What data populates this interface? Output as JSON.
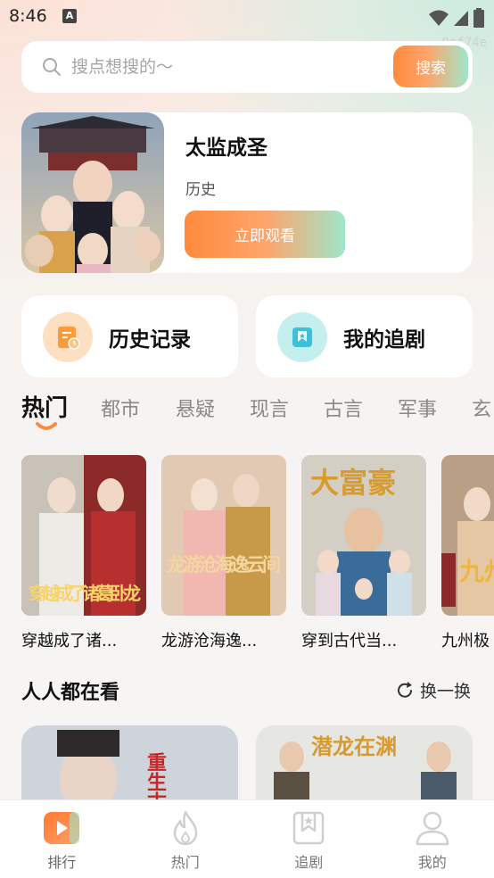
{
  "status": {
    "time": "8:46",
    "notification_icon": "A"
  },
  "watermark": "0ef74e",
  "search": {
    "placeholder": "搜点想搜的～",
    "button_label": "搜索"
  },
  "featured": {
    "title": "太监成圣",
    "tag": "历史",
    "watch_label": "立即观看"
  },
  "quick": {
    "history_label": "历史记录",
    "follow_label": "我的追剧"
  },
  "tabs": [
    "热门",
    "都市",
    "悬疑",
    "现言",
    "古言",
    "军事",
    "玄"
  ],
  "dramas": [
    {
      "title": "穿越成了诸...",
      "cover_text": "穿越成了诸葛卧龙"
    },
    {
      "title": "龙游沧海逸...",
      "cover_text": "龙游沧海逸云间"
    },
    {
      "title": "穿到古代当...",
      "cover_text": "大富豪"
    },
    {
      "title": "九州极",
      "cover_text": "九州极"
    }
  ],
  "section": {
    "title": "人人都在看",
    "refresh_label": "换一换"
  },
  "watching": [
    {
      "cover_text": "重生古王"
    },
    {
      "cover_text": "潜龙在渊"
    }
  ],
  "tabbar": {
    "items": [
      {
        "label": "排行",
        "icon": "play-icon"
      },
      {
        "label": "热门",
        "icon": "flame-icon"
      },
      {
        "label": "追剧",
        "icon": "bookmark-star-icon"
      },
      {
        "label": "我的",
        "icon": "user-icon"
      }
    ]
  },
  "colors": {
    "accent_orange": "#ff8a3d",
    "accent_mint": "#9fe6c9"
  }
}
